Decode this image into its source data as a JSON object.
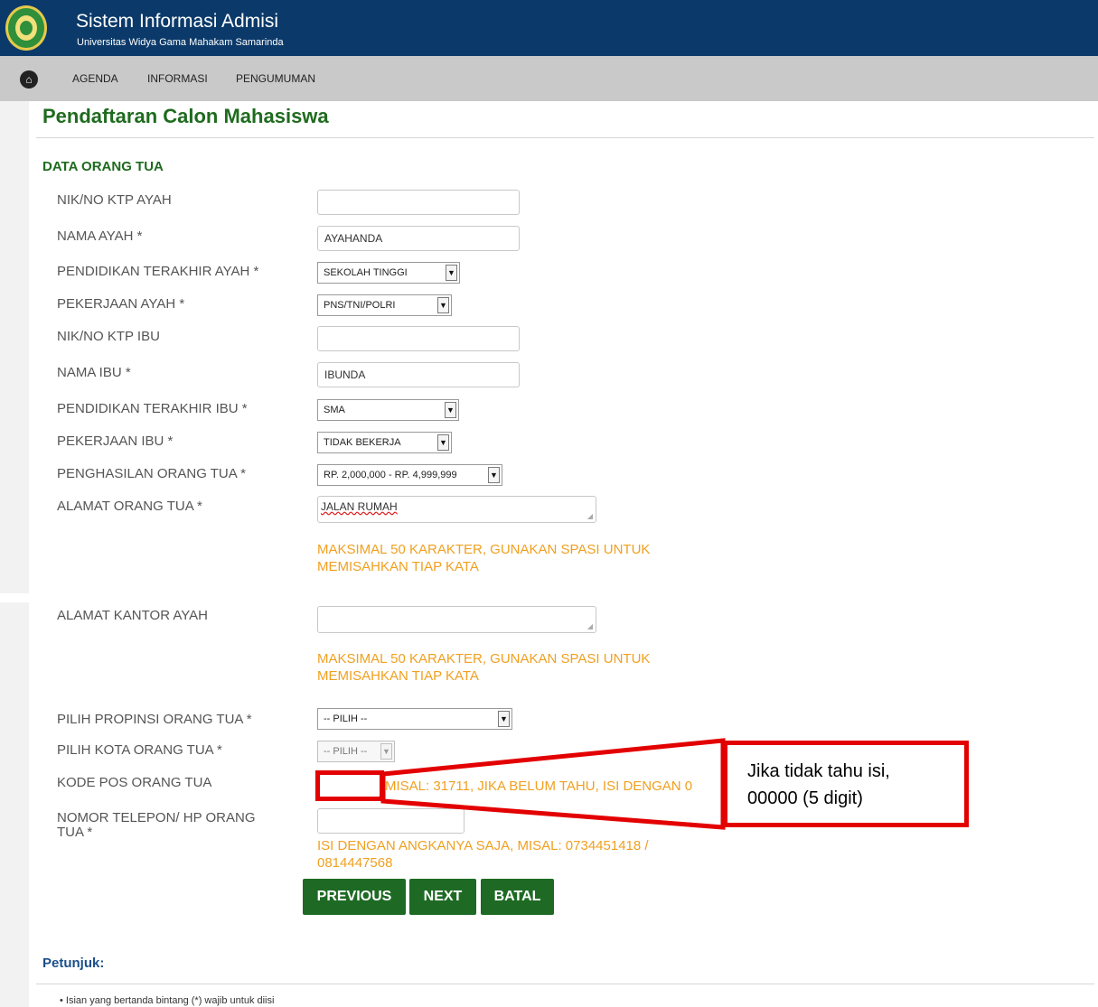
{
  "header": {
    "app_title": "Sistem Informasi Admisi",
    "app_subtitle": "Universitas Widya Gama Mahakam Samarinda",
    "brand_color": "#0b3a6a"
  },
  "nav": {
    "items": [
      "AGENDA",
      "INFORMASI",
      "PENGUMUMAN"
    ]
  },
  "page": {
    "title": "Pendaftaran Calon Mahasiswa",
    "section_title": "DATA ORANG TUA",
    "accent_color": "#1f6b1f"
  },
  "form": {
    "nik_ayah": {
      "label": "NIK/NO KTP AYAH",
      "value": ""
    },
    "nama_ayah": {
      "label": "NAMA AYAH *",
      "value": "AYAHANDA"
    },
    "pendidikan_ayah": {
      "label": "PENDIDIKAN TERAKHIR AYAH *",
      "selected": "SEKOLAH TINGGI"
    },
    "pekerjaan_ayah": {
      "label": "PEKERJAAN AYAH *",
      "selected": "PNS/TNI/POLRI"
    },
    "nik_ibu": {
      "label": "NIK/NO KTP IBU",
      "value": ""
    },
    "nama_ibu": {
      "label": "NAMA IBU *",
      "value": "IBUNDA"
    },
    "pendidikan_ibu": {
      "label": "PENDIDIKAN TERAKHIR IBU *",
      "selected": "SMA"
    },
    "pekerjaan_ibu": {
      "label": "PEKERJAAN IBU *",
      "selected": "TIDAK BEKERJA"
    },
    "penghasilan": {
      "label": "PENGHASILAN ORANG TUA *",
      "selected": "RP. 2,000,000 - RP. 4,999,999"
    },
    "alamat_ortu": {
      "label": "ALAMAT ORANG TUA *",
      "value": "JALAN RUMAH",
      "hint_line1": "MAKSIMAL 50 KARAKTER, GUNAKAN SPASI UNTUK",
      "hint_line2": "MEMISAHKAN TIAP KATA"
    },
    "alamat_kantor": {
      "label": "ALAMAT KANTOR AYAH",
      "value": "",
      "hint_line1": "MAKSIMAL 50 KARAKTER, GUNAKAN SPASI UNTUK",
      "hint_line2": "MEMISAHKAN TIAP KATA"
    },
    "propinsi": {
      "label": "PILIH PROPINSI ORANG TUA *",
      "selected": "-- PILIH --"
    },
    "kota": {
      "label": "PILIH KOTA ORANG TUA *",
      "selected": "-- PILIH --"
    },
    "kode_pos": {
      "label": "KODE POS ORANG TUA",
      "value": "",
      "hint": "MISAL: 31711, JIKA BELUM TAHU, ISI DENGAN 0"
    },
    "telepon": {
      "label_line1": "NOMOR TELEPON/ HP ORANG",
      "label_line2": "TUA *",
      "value": "",
      "hint_line1": "ISI DENGAN ANGKANYA SAJA, MISAL: 0734451418 /",
      "hint_line2": "0814447568"
    }
  },
  "buttons": {
    "previous": "PREVIOUS",
    "next": "NEXT",
    "batal": "BATAL"
  },
  "petunjuk": {
    "title": "Petunjuk:",
    "item1": "Isian yang bertanda bintang (*) wajib untuk diisi"
  },
  "annotation": {
    "line1": "Jika tidak tahu isi,",
    "line2": "00000 (5 digit)",
    "color": "#e30000"
  }
}
